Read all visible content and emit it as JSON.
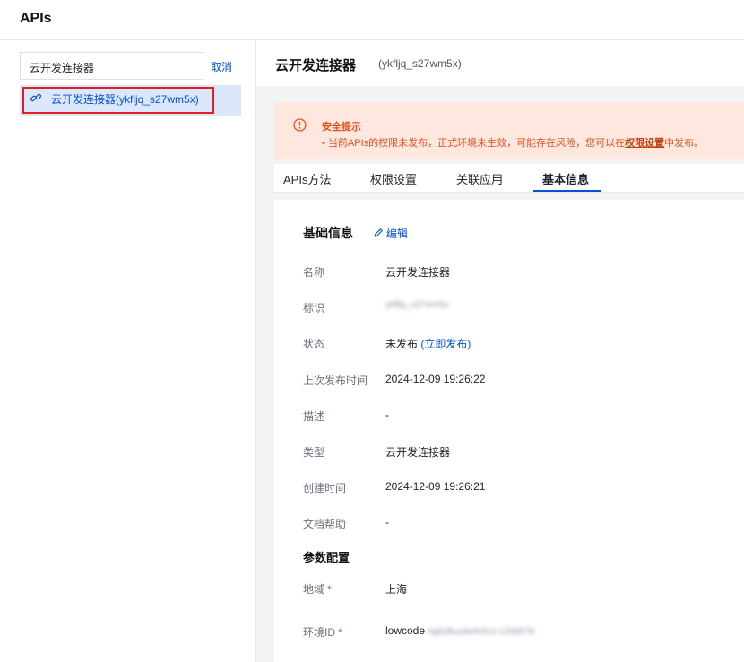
{
  "header": {
    "title": "APIs"
  },
  "sidebar": {
    "search_value": "云开发连接器",
    "cancel_label": "取消",
    "items": [
      {
        "label": "云开发连接器(ykfljq_s27wm5x)"
      }
    ]
  },
  "main": {
    "title": "云开发连接器",
    "subtitle": "(ykfljq_s27wm5x)",
    "alert": {
      "title": "安全提示",
      "text_before": "• 当前APIs的权限未发布，正式环境未生效，可能存在风险，您可以在",
      "link": "权限设置",
      "text_after": "中发布。"
    },
    "tabs": [
      {
        "label": "APIs方法"
      },
      {
        "label": "权限设置"
      },
      {
        "label": "关联应用"
      },
      {
        "label": "基本信息"
      }
    ],
    "active_tab": "基本信息",
    "basic_info": {
      "title": "基础信息",
      "edit_label": "编辑",
      "rows": [
        {
          "label": "名称",
          "value": "云开发连接器"
        },
        {
          "label": "标识",
          "value": "ykfljq_s27wm5x"
        },
        {
          "label": "状态",
          "value": "未发布",
          "link": "(立即发布)"
        },
        {
          "label": "上次发布时间",
          "value": "2024-12-09 19:26:22"
        },
        {
          "label": "描述",
          "value": "-"
        },
        {
          "label": "类型",
          "value": "云开发连接器"
        },
        {
          "label": "创建时间",
          "value": "2024-12-09 19:26:21"
        },
        {
          "label": "文档帮助",
          "value": "-"
        }
      ]
    },
    "params": {
      "title": "参数配置",
      "rows": [
        {
          "label": "地域",
          "required_mark": "*",
          "value": "上海"
        },
        {
          "label": "环境ID",
          "required_mark": "*",
          "value": "lowcode",
          "value_blurred": "-4gbxfkuoke9r51e-1336576"
        }
      ]
    }
  },
  "colors": {
    "accent": "#0052d9",
    "warning": "#e0531e",
    "highlight_border": "#e02020"
  }
}
